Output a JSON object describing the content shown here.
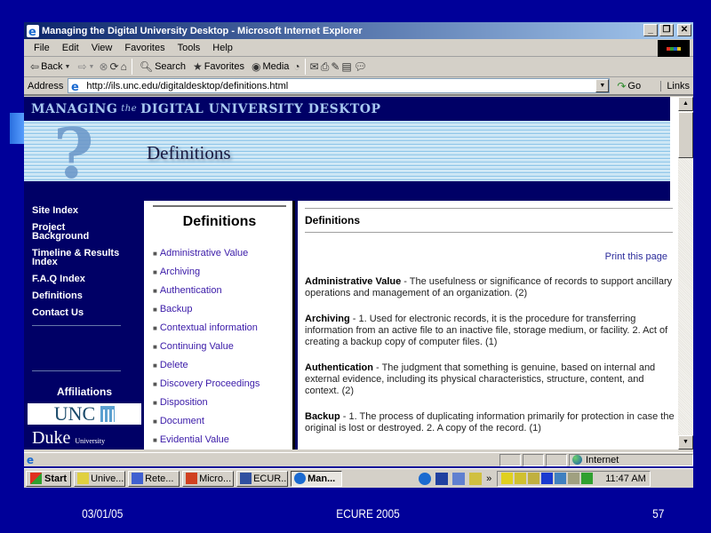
{
  "window": {
    "title": "Managing the Digital University Desktop - Microsoft Internet Explorer",
    "controls": [
      "_",
      "❐",
      "✕"
    ]
  },
  "menu": [
    "File",
    "Edit",
    "View",
    "Favorites",
    "Tools",
    "Help"
  ],
  "toolbar": {
    "back": "Back",
    "search": "Search",
    "favorites": "Favorites",
    "media": "Media"
  },
  "address": {
    "label": "Address",
    "url": "http://ils.unc.edu/digitaldesktop/definitions.html",
    "go": "Go",
    "links": "Links"
  },
  "banner": {
    "site_title_part1": "MANAGING",
    "site_title_the": "the",
    "site_title_part2": "DIGITAL UNIVERSITY DESKTOP",
    "page_title": "Definitions"
  },
  "leftnav": {
    "items": [
      "Site Index",
      "Project Background",
      "Timeline & Results Index",
      "F.A.Q Index",
      "Definitions",
      "Contact Us"
    ],
    "affiliations_heading": "Affiliations",
    "unc_logo": "UNC",
    "duke_logo": "Duke",
    "duke_sub": "University"
  },
  "sidebar": {
    "title": "Definitions",
    "links": [
      "Administrative Value",
      "Archiving",
      "Authentication",
      "Backup",
      "Contextual information",
      "Continuing Value",
      "Delete",
      "Discovery Proceedings",
      "Disposition",
      "Document",
      "Evidential Value"
    ]
  },
  "content": {
    "heading": "Definitions",
    "print_link": "Print this page",
    "definitions": [
      {
        "term": "Administrative Value",
        "text": " - The usefulness or significance of records to support ancillary operations and management of an organization. (2)"
      },
      {
        "term": "Archiving",
        "text": " - 1. Used for electronic records, it is the procedure for transferring information from an active file to an inactive file, storage medium, or facility. 2. Act of creating a backup copy of computer files. (1)"
      },
      {
        "term": "Authentication",
        "text": " - The judgment that something is genuine, based on internal and external evidence, including its physical characteristics, structure, content, and context. (2)"
      },
      {
        "term": "Backup",
        "text": " - 1. The process of duplicating information primarily for protection in case the original is lost or destroyed. 2. A copy of the record. (1)"
      }
    ]
  },
  "statusbar": {
    "zone": "Internet"
  },
  "taskbar": {
    "start": "Start",
    "tasks": [
      {
        "label": "Unive...",
        "active": false
      },
      {
        "label": "Rete...",
        "active": false
      },
      {
        "label": "Micro...",
        "active": false
      },
      {
        "label": "ECUR...",
        "active": false
      },
      {
        "label": "Man...",
        "active": true
      }
    ],
    "chevron": "»",
    "clock": "11:47 AM"
  },
  "slide_footer": {
    "date": "03/01/05",
    "center": "ECURE 2005",
    "page": "57"
  }
}
